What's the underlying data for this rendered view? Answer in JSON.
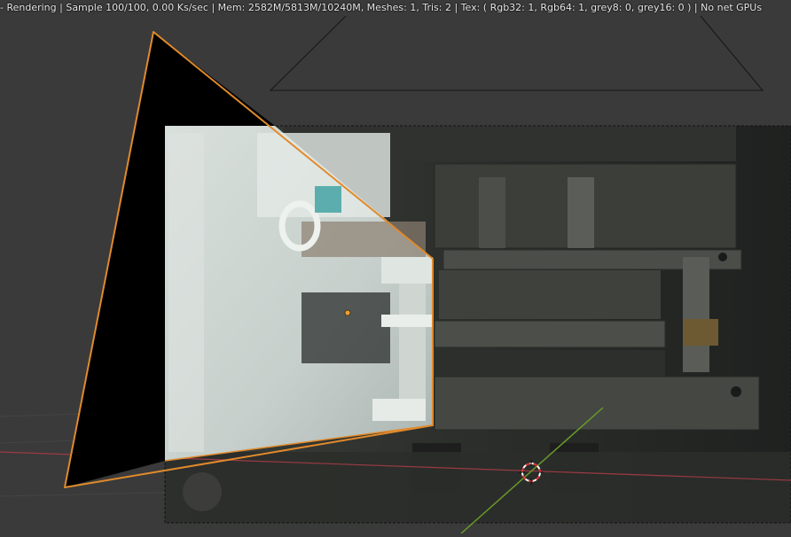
{
  "status_bar": {
    "text": "- Rendering | Sample 100/100, 0.00 Ks/sec | Mem: 2582M/5813M/10240M, Meshes: 1, Tris: 2 | Tex: ( Rgb32: 1, Rgb64: 1, grey8: 0, grey16: 0 ) | No net GPUs"
  },
  "colors": {
    "viewport_background": "#3a3a3a",
    "selection_outline": "#e08a2c",
    "x_axis": "#9c3a44",
    "y_axis": "#6a9a2a",
    "cursor_red": "#d83a3a"
  },
  "icons": {
    "cursor": "3d-cursor-icon",
    "origin": "object-origin-icon"
  }
}
